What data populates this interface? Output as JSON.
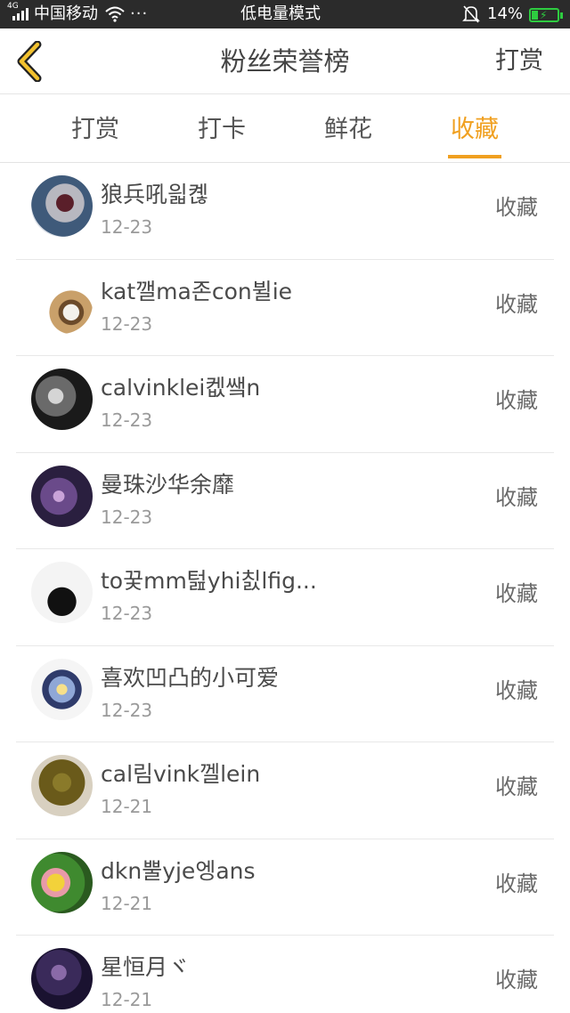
{
  "status_bar": {
    "network": "4G",
    "carrier": "中国移动",
    "dots": "···",
    "mode": "低电量模式",
    "battery_pct": "14%"
  },
  "header": {
    "back_icon": "chevron-left-icon",
    "title": "粉丝荣誉榜",
    "action": "打赏"
  },
  "tabs": [
    {
      "label": "打赏",
      "active": false
    },
    {
      "label": "打卡",
      "active": false
    },
    {
      "label": "鲜花",
      "active": false
    },
    {
      "label": "收藏",
      "active": true
    }
  ],
  "colors": {
    "accent": "#f0a020",
    "status_bar_bg": "#2b2b2b",
    "battery": "#2ecc40"
  },
  "list": [
    {
      "name": "狼兵吼읣켾",
      "date": "12-23",
      "action": "收藏"
    },
    {
      "name": "kat깰ma존con뷜ie",
      "date": "12-23",
      "action": "收藏"
    },
    {
      "name": "calvinklei켒쌬n",
      "date": "12-23",
      "action": "收藏"
    },
    {
      "name": "曼珠沙华余靡",
      "date": "12-23",
      "action": "收藏"
    },
    {
      "name": "to꿎mm턾yhi칤lfig...",
      "date": "12-23",
      "action": "收藏"
    },
    {
      "name": "喜欢凹凸的小可爱",
      "date": "12-23",
      "action": "收藏"
    },
    {
      "name": "cal림vink껠lein",
      "date": "12-21",
      "action": "收藏"
    },
    {
      "name": "dkn뿔yje엥ans",
      "date": "12-21",
      "action": "收藏"
    },
    {
      "name": "星恒月ヾ",
      "date": "12-21",
      "action": "收藏"
    }
  ]
}
